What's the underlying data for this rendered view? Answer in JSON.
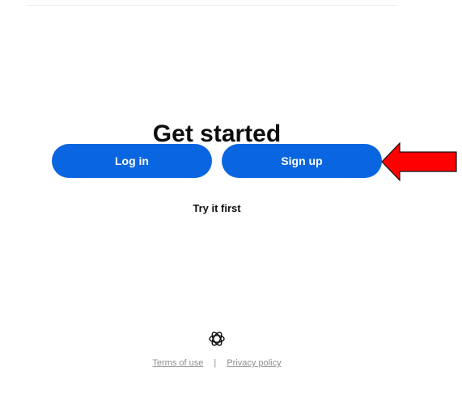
{
  "page": {
    "title": "Get started"
  },
  "actions": {
    "login_label": "Log in",
    "signup_label": "Sign up",
    "try_label": "Try it first"
  },
  "footer": {
    "terms_label": "Terms of use",
    "separator": "|",
    "privacy_label": "Privacy policy"
  },
  "annotation": {
    "arrow_color": "#ff0000",
    "points_to": "signup-button"
  },
  "colors": {
    "primary_button": "#0a66e0",
    "footer_text": "#8e8e8e"
  },
  "icons": {
    "logo": "openai-logo-icon",
    "annotation": "red-arrow-icon"
  }
}
